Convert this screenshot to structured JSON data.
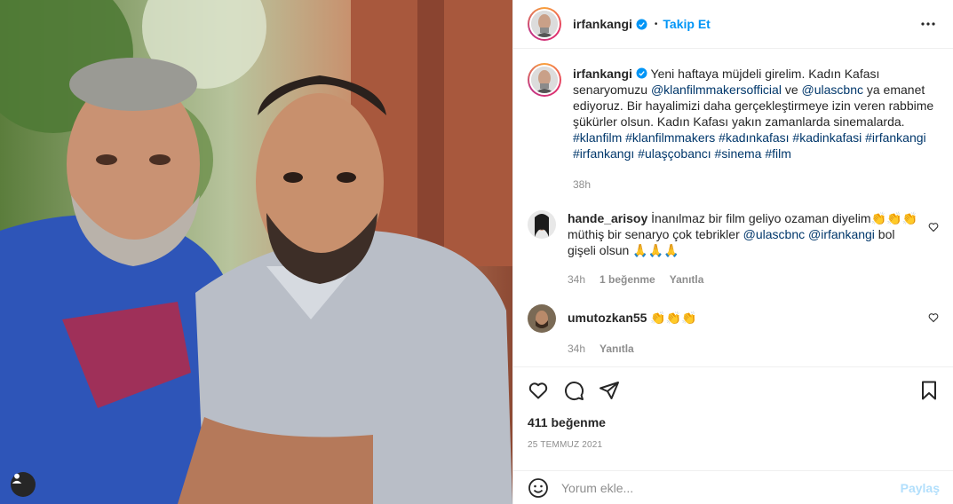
{
  "post": {
    "author": "irfankangi",
    "follow_label": "Takip Et",
    "separator": "•",
    "more_icon": "more-horizontal-icon",
    "verified_icon": "verified-badge-icon",
    "accent_color": "#0095f6"
  },
  "caption": {
    "author": "irfankangi",
    "text_1": "Yeni haftaya müjdeli girelim. Kadın Kafası senaryomuzu ",
    "mention_1": "@klanfilmmakersofficial",
    "text_2": " ve ",
    "mention_2": "@ulascbnc",
    "text_3": " ya emanet ediyoruz. Bir hayalimizi daha gerçekleştirmeye izin veren rabbime şükürler olsun. Kadın Kafası yakın zamanlarda sinemalarda.",
    "hashtags": "#klanfilm #klanfilmmakers #kadınkafası #kadinkafasi #irfankangi #irfankangı #ulaşçobancı #sinema #film",
    "time": "38h"
  },
  "comments": [
    {
      "author": "hande_arisoy",
      "text_1": "İnanılmaz bir film geliyo ozaman diyelim👏👏👏 müthiş bir senaryo çok tebrikler ",
      "mention_1": "@ulascbnc",
      "text_2": " ",
      "mention_2": "@irfankangi",
      "text_3": " bol gişeli olsun 🙏🙏🙏",
      "time": "34h",
      "likes": "1 beğenme",
      "reply": "Yanıtla"
    },
    {
      "author": "umutozkan55",
      "text_1": "👏👏👏",
      "time": "34h",
      "reply": "Yanıtla"
    }
  ],
  "actions": {
    "like_icon": "heart-icon",
    "comment_icon": "comment-icon",
    "share_icon": "paper-plane-icon",
    "save_icon": "bookmark-icon",
    "likes": "411 beğenme",
    "date": "25 TEMMUZ 2021"
  },
  "add_comment": {
    "placeholder": "Yorum ekle...",
    "post_label": "Paylaş",
    "emoji_icon": "emoji-smile-icon"
  }
}
